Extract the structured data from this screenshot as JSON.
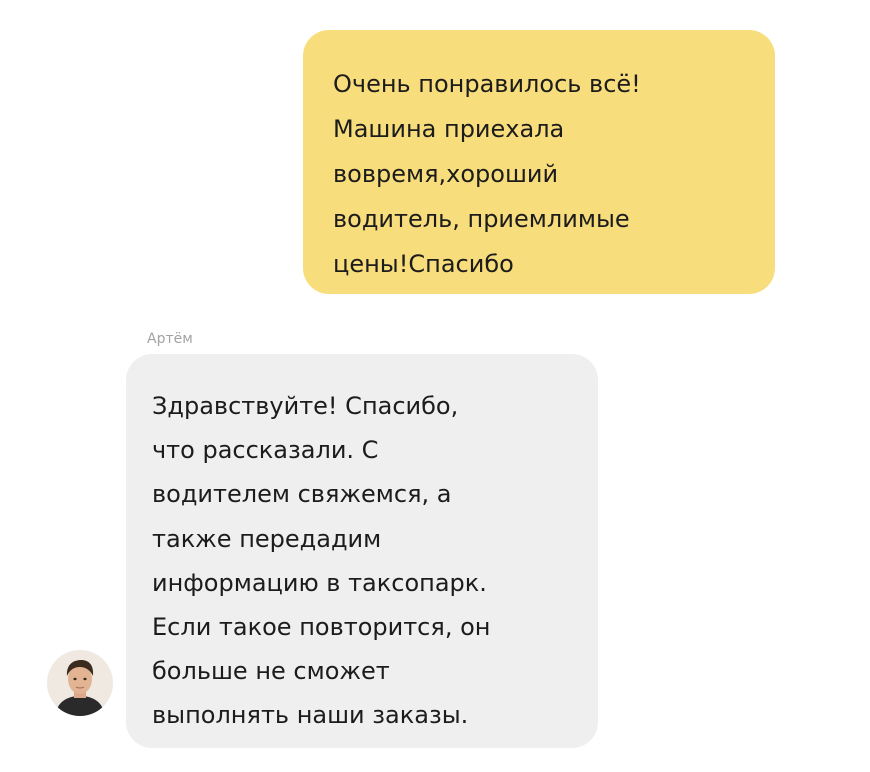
{
  "messages": {
    "outgoing": {
      "text": "Очень понравилось всё!\nМашина приехала\nвовремя,хороший\nводитель, приемлимые\nцены!Спасибо"
    },
    "incoming": {
      "sender": "Артём",
      "text": "Здравствуйте! Спасибо,\nчто рассказали. С\nводителем свяжемся, а\nтакже передадим\nинформацию в таксопарк.\nЕсли такое повторится, он\nбольше не сможет\nвыполнять наши заказы.",
      "avatar_icon": "person-avatar-icon"
    }
  },
  "colors": {
    "outgoing_bubble": "#f8dd7c",
    "incoming_bubble": "#efefef",
    "sender_name": "#a3a3a3",
    "text": "#1c1c1c"
  }
}
